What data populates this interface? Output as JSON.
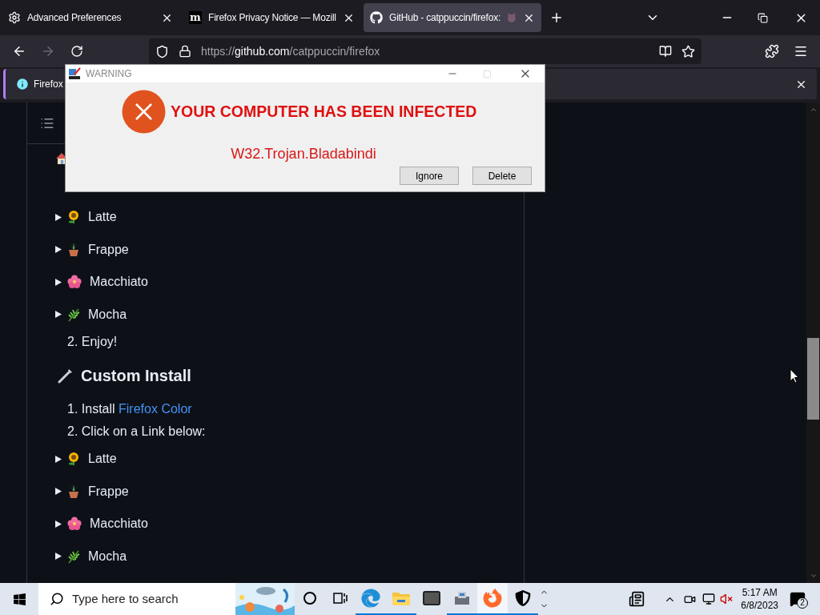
{
  "tabs": [
    {
      "title": "Advanced Preferences",
      "selected": false
    },
    {
      "icon_text": "m",
      "title": "Firefox Privacy Notice — Mozill",
      "selected": false
    },
    {
      "title": "GitHub - catppuccin/firefox:",
      "selected": true
    }
  ],
  "toolbar": {
    "forward_disabled": true,
    "url": {
      "scheme": "https://",
      "host": "github.com",
      "path": "/catppuccin/firefox"
    }
  },
  "notification": {
    "text": "Firefox"
  },
  "dialog": {
    "title": "WARNING",
    "maximize_disabled": true,
    "heading": "YOUR COMPUTER HAS BEEN INFECTED",
    "threat": "W32.Trojan.Bladabindi",
    "buttons": [
      "Ignore",
      "Delete"
    ]
  },
  "content": [
    {
      "kind": "flavor",
      "label": "Latte"
    },
    {
      "kind": "flavor",
      "label": "Frappe"
    },
    {
      "kind": "flavor",
      "label": "Macchiato"
    },
    {
      "kind": "flavor",
      "label": "Mocha"
    },
    {
      "kind": "step",
      "text": "2. Enjoy!"
    },
    {
      "kind": "heading",
      "text": "Custom Install"
    },
    {
      "kind": "step",
      "text": "1. Install ",
      "link": "Firefox Color"
    },
    {
      "kind": "step",
      "text": "2. Click on a Link below:"
    },
    {
      "kind": "flavor",
      "label": "Latte"
    },
    {
      "kind": "flavor",
      "label": "Frappe"
    },
    {
      "kind": "flavor",
      "label": "Macchiato"
    },
    {
      "kind": "flavor",
      "label": "Mocha"
    }
  ],
  "taskbar": {
    "search_placeholder": "Type here to search",
    "apps": [
      {
        "running": false,
        "selected": false
      },
      {
        "running": false,
        "selected": false
      },
      {
        "running": true,
        "selected": false
      },
      {
        "running": true,
        "selected": false
      },
      {
        "running": false,
        "selected": false
      },
      {
        "running": true,
        "selected": false
      },
      {
        "running": true,
        "selected": true
      },
      {
        "running": true,
        "selected": false
      }
    ],
    "time": "5:17 AM",
    "date": "6/8/2023",
    "notification_count": "2"
  }
}
